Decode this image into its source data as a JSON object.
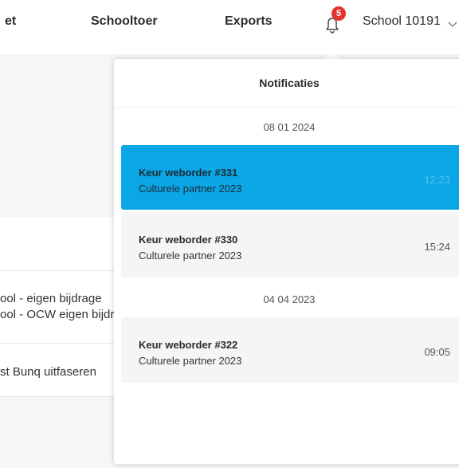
{
  "nav": {
    "item_partial": "et",
    "item_schooltoer": "Schooltoer",
    "item_exports": "Exports",
    "notification_count": "5",
    "school_name": "School 10191"
  },
  "background": {
    "row1_line1": "ool - eigen bijdrage",
    "row1_line2": "ool - OCW eigen bijdrage",
    "row2": "st Bunq uitfaseren"
  },
  "notifications": {
    "title": "Notificaties",
    "groups": [
      {
        "date": "08 01 2024",
        "items": [
          {
            "title": "Keur weborder #331",
            "subtitle": "Culturele partner 2023",
            "time": "12:23",
            "active": true
          },
          {
            "title": "Keur weborder #330",
            "subtitle": "Culturele partner 2023",
            "time": "15:24",
            "active": false
          }
        ]
      },
      {
        "date": "04 04 2023",
        "items": [
          {
            "title": "Keur weborder #322",
            "subtitle": "Culturele partner 2023",
            "time": "09:05",
            "active": false
          }
        ]
      }
    ]
  },
  "colors": {
    "accent": "#0aa6e5",
    "badge": "#e3342f"
  },
  "icons": {
    "bell": "bell-icon",
    "chevron": "chevron-down-icon"
  }
}
